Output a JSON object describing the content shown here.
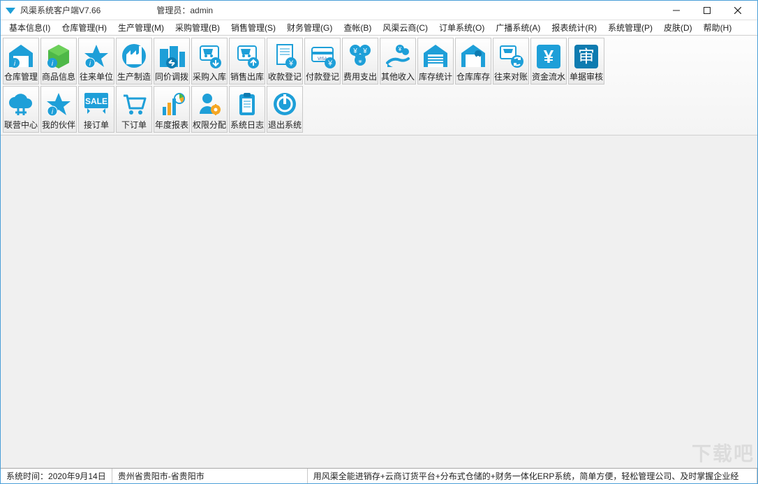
{
  "titlebar": {
    "app_title": "风渠系统客户端V7.66",
    "admin_label": "管理员：admin"
  },
  "menu": [
    "基本信息(I)",
    "仓库管理(H)",
    "生产管理(M)",
    "采购管理(B)",
    "销售管理(S)",
    "财务管理(G)",
    "查帐(B)",
    "风渠云商(C)",
    "订单系统(O)",
    "广播系统(A)",
    "报表统计(R)",
    "系统管理(P)",
    "皮肤(D)",
    "帮助(H)"
  ],
  "toolbar": {
    "row1": [
      {
        "label": "仓库管理",
        "icon": "warehouse"
      },
      {
        "label": "商品信息",
        "icon": "box"
      },
      {
        "label": "往来单位",
        "icon": "star"
      },
      {
        "label": "生产制造",
        "icon": "factory"
      },
      {
        "label": "同价调拨",
        "icon": "buildings"
      },
      {
        "label": "采购入库",
        "icon": "cart-in"
      },
      {
        "label": "销售出库",
        "icon": "cart-out"
      },
      {
        "label": "收款登记",
        "icon": "receipt"
      },
      {
        "label": "付款登记",
        "icon": "card"
      },
      {
        "label": "费用支出",
        "icon": "coin-out"
      },
      {
        "label": "其他收入",
        "icon": "coin-in"
      },
      {
        "label": "库存统计",
        "icon": "garage"
      },
      {
        "label": "仓库库存",
        "icon": "house-pin"
      },
      {
        "label": "往来对账",
        "icon": "reconcile"
      },
      {
        "label": "资金流水",
        "icon": "yen"
      },
      {
        "label": "单据审核",
        "icon": "audit"
      }
    ],
    "row2": [
      {
        "label": "联营中心",
        "icon": "cloud"
      },
      {
        "label": "我的伙伴",
        "icon": "star"
      },
      {
        "label": "接订单",
        "icon": "sale"
      },
      {
        "label": "下订单",
        "icon": "shopcart"
      },
      {
        "label": "年度报表",
        "icon": "chart"
      },
      {
        "label": "权限分配",
        "icon": "user-gear"
      },
      {
        "label": "系统日志",
        "icon": "clipboard"
      },
      {
        "label": "退出系统",
        "icon": "power"
      }
    ]
  },
  "statusbar": {
    "time_label": "系统时间：",
    "time_value": "2020年9月14日",
    "location": "贵州省贵阳市-省贵阳市",
    "message": "用风渠全能进销存+云商订货平台+分布式仓储的+财务一体化ERP系统，简单方便，轻松管理公司、及时掌握企业经"
  },
  "watermark": "下载吧"
}
